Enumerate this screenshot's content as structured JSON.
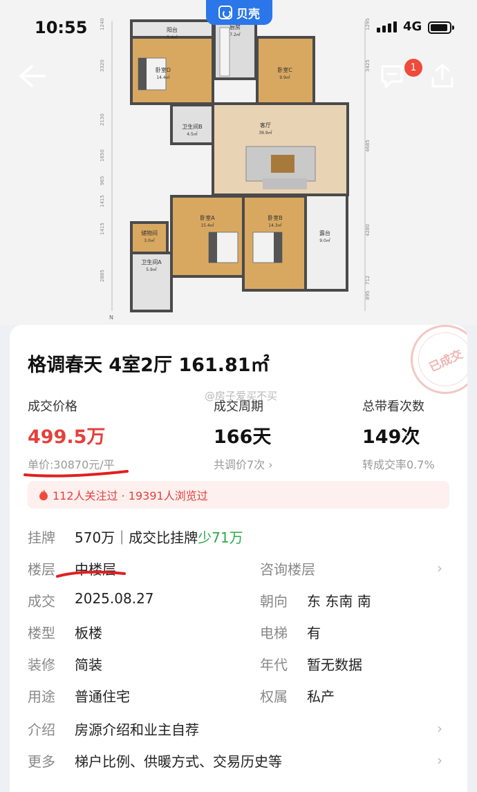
{
  "status": {
    "time": "10:55",
    "network": "4G"
  },
  "brand": {
    "name": "贝壳"
  },
  "badge": {
    "count": "1"
  },
  "floorplan": {
    "rooms": [
      {
        "name": "阳台",
        "area": "5.4㎡"
      },
      {
        "name": "厨房",
        "area": "7.2㎡"
      },
      {
        "name": "卧室D",
        "area": "14.4㎡"
      },
      {
        "name": "卧室C",
        "area": "9.9㎡"
      },
      {
        "name": "卫生间B",
        "area": "4.5㎡"
      },
      {
        "name": "客厅",
        "area": "39.9㎡"
      },
      {
        "name": "卧室A",
        "area": "15.4㎡"
      },
      {
        "name": "卧室B",
        "area": "14.3㎡"
      },
      {
        "name": "储物间",
        "area": "3.0㎡"
      },
      {
        "name": "卫生间A",
        "area": "5.9㎡"
      },
      {
        "name": "露台",
        "area": "9.0㎡"
      }
    ],
    "dims_left": [
      "1240",
      "3320",
      "2130",
      "1650",
      "965",
      "1415",
      "1415",
      "2885"
    ],
    "dims_right": [
      "1295",
      "3425",
      "4685",
      "4280",
      "712",
      "895"
    ],
    "north": "N"
  },
  "listing": {
    "title": "格调春天 4室2厅 161.81㎡",
    "stamp": "已成交",
    "watermark": "@房子爱买不买",
    "stats": {
      "price": {
        "label": "成交价格",
        "value": "499.5万",
        "sub": "单价:30870元/平"
      },
      "cycle": {
        "label": "成交周期",
        "value": "166天",
        "sub": "共调价7次 ›"
      },
      "views": {
        "label": "总带看次数",
        "value": "149次",
        "sub": "转成交率0.7%"
      }
    },
    "attention": "112人关注过 · 19391人浏览过",
    "details": {
      "listing_label": "挂牌",
      "listing_value": "570万｜成交比挂牌",
      "listing_diff": "少71万",
      "floor_label": "楼层",
      "floor_value": "中楼层",
      "floor_link": "咨询楼层",
      "deal_label": "成交",
      "deal_value": "2025.08.27",
      "orient_label": "朝向",
      "orient_value": "东 东南 南",
      "type_label": "楼型",
      "type_value": "板楼",
      "elevator_label": "电梯",
      "elevator_value": "有",
      "deco_label": "装修",
      "deco_value": "简装",
      "year_label": "年代",
      "year_value": "暂无数据",
      "use_label": "用途",
      "use_value": "普通住宅",
      "own_label": "权属",
      "own_value": "私产",
      "intro_label": "介绍",
      "intro_value": "房源介绍和业主自荐",
      "more_label": "更多",
      "more_value": "梯户比例、供暖方式、交易历史等"
    }
  },
  "colors": {
    "price_red": "#e5403a",
    "brand_blue": "#2b76e8",
    "green": "#2ea84a",
    "link_blue": "#3a6fd8"
  }
}
